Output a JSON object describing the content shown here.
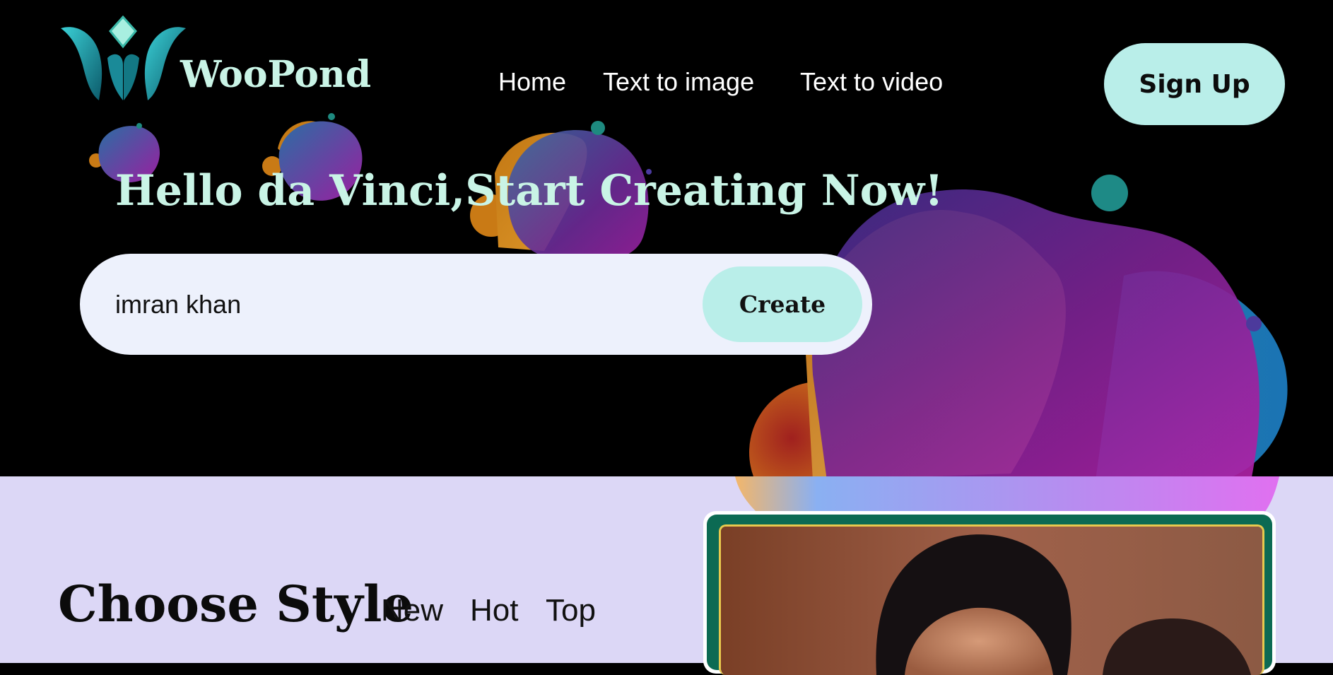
{
  "brand": {
    "name": "WooPond"
  },
  "nav": {
    "items": [
      "Home",
      "Text to image",
      "Text to video"
    ]
  },
  "header": {
    "signup_label": "Sign Up"
  },
  "hero": {
    "headline": "Hello da Vinci,Start Creating Now!",
    "search_value": "imran khan",
    "create_label": "Create"
  },
  "styles": {
    "title": "Choose Style",
    "filters": [
      "New",
      "Hot",
      "Top"
    ]
  },
  "colors": {
    "accent": "#b9eee9",
    "headline": "#c9f4e6",
    "hero_bg": "#000000",
    "lower_bg": "#dcd7f6",
    "frame": "#0c6a53"
  },
  "icons": {
    "logo": "woopond-logo-icon"
  }
}
